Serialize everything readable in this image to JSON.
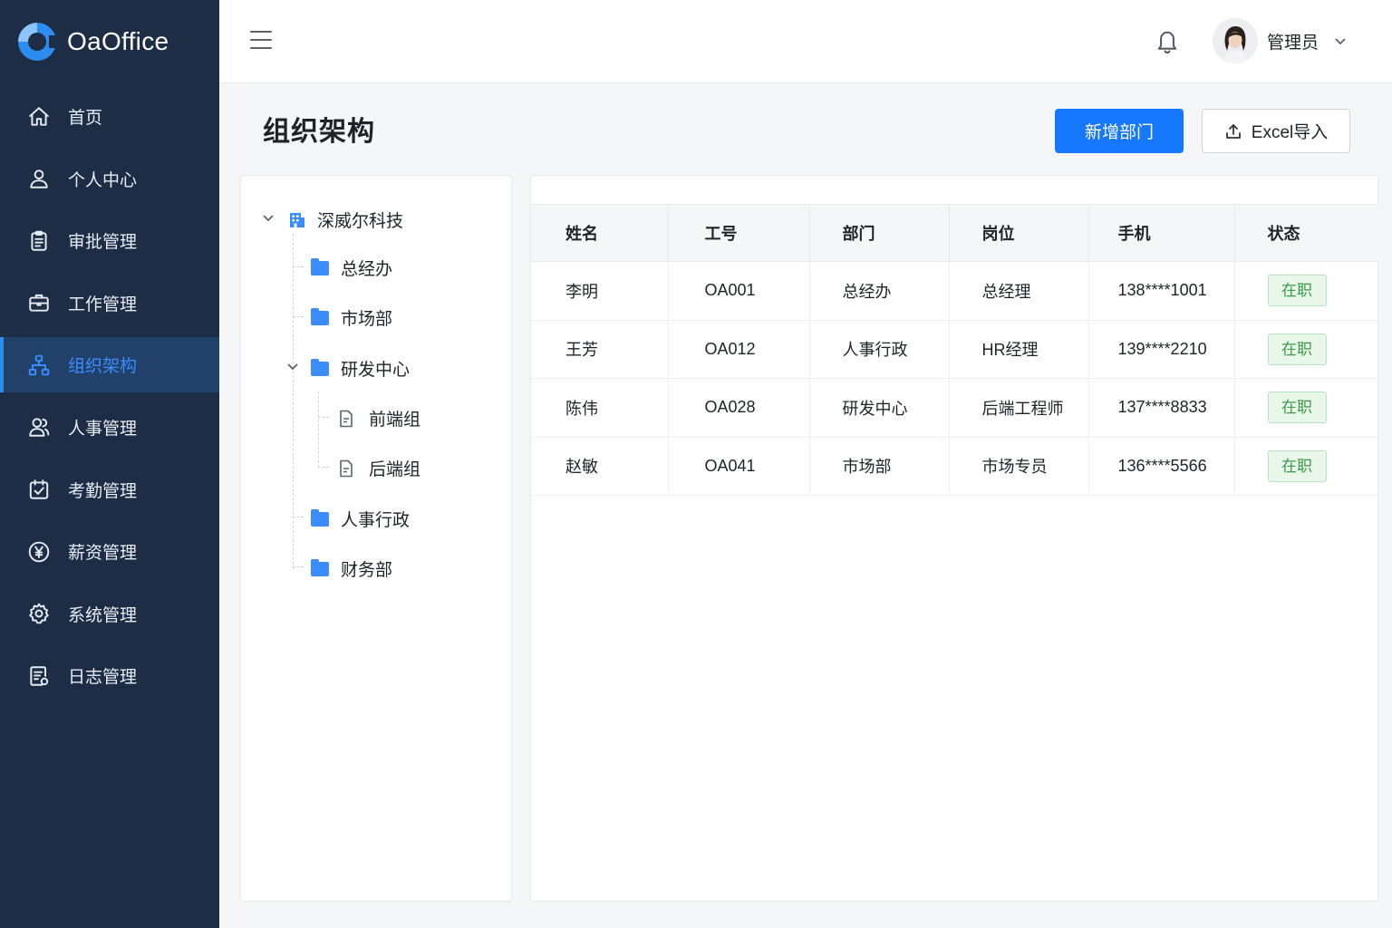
{
  "brand": {
    "name": "OaOffice"
  },
  "sidebar": {
    "items": [
      {
        "label": "首页",
        "icon": "home-icon"
      },
      {
        "label": "个人中心",
        "icon": "user-icon"
      },
      {
        "label": "审批管理",
        "icon": "clipboard-icon"
      },
      {
        "label": "工作管理",
        "icon": "briefcase-icon"
      },
      {
        "label": "组织架构",
        "icon": "org-chart-icon",
        "active": true
      },
      {
        "label": "人事管理",
        "icon": "users-icon"
      },
      {
        "label": "考勤管理",
        "icon": "calendar-check-icon"
      },
      {
        "label": "薪资管理",
        "icon": "yen-icon"
      },
      {
        "label": "系统管理",
        "icon": "gear-icon"
      },
      {
        "label": "日志管理",
        "icon": "log-icon"
      }
    ]
  },
  "header": {
    "user_name": "管理员"
  },
  "page": {
    "title": "组织架构",
    "add_button": "新增部门",
    "import_button": "Excel导入"
  },
  "tree": {
    "root": "深威尔科技",
    "nodes": [
      "总经办",
      "市场部",
      "研发中心",
      "前端组",
      "后端组",
      "人事行政",
      "财务部"
    ]
  },
  "table": {
    "headers": [
      "姓名",
      "工号",
      "部门",
      "岗位",
      "手机",
      "状态"
    ],
    "rows": [
      [
        "李明",
        "OA001",
        "总经办",
        "总经理",
        "138****1001",
        "在职"
      ],
      [
        "王芳",
        "OA012",
        "人事行政",
        "HR经理",
        "139****2210",
        "在职"
      ],
      [
        "陈伟",
        "OA028",
        "研发中心",
        "后端工程师",
        "137****8833",
        "在职"
      ],
      [
        "赵敏",
        "OA041",
        "市场部",
        "市场专员",
        "136****5566",
        "在职"
      ]
    ]
  },
  "colors": {
    "sidebar_bg": "#1d2d45",
    "accent": "#1677ff",
    "status_green": "#3a9a4a"
  }
}
